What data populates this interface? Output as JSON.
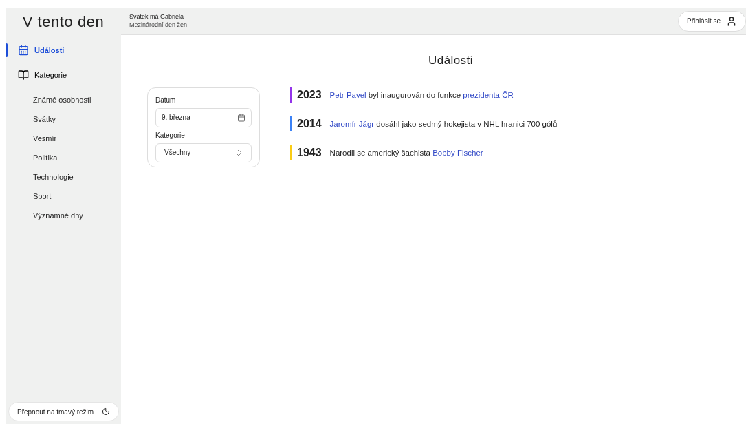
{
  "sidebar": {
    "title": "V tento den",
    "nav": [
      {
        "label": "Události",
        "kind": "calendar",
        "selected": true
      },
      {
        "label": "Kategorie",
        "kind": "book",
        "selected": false
      }
    ],
    "categories": [
      "Známé osobnosti",
      "Svátky",
      "Vesmír",
      "Politika",
      "Technologie",
      "Sport",
      "Významné dny"
    ],
    "theme_button": "Přepnout na tmavý režim"
  },
  "header": {
    "name_day": "Svátek má Gabriela",
    "day": "Mezinárodní den žen",
    "login_button": "Přihlásit se"
  },
  "main": {
    "title": "Události",
    "filter": {
      "date_label": "Datum",
      "date_value": "9. března",
      "category_label": "Kategorie",
      "category_value": "Všechny"
    },
    "events": [
      {
        "year": "2023",
        "color": "#9333ea",
        "parts": [
          {
            "kind": "link",
            "text": "Petr Pavel"
          },
          {
            "kind": "text",
            "text": " byl inaugurován do funkce "
          },
          {
            "kind": "link",
            "text": "prezidenta ČR"
          }
        ]
      },
      {
        "year": "2014",
        "color": "#3b82f6",
        "parts": [
          {
            "kind": "link",
            "text": "Jaromír Jágr"
          },
          {
            "kind": "text",
            "text": " dosáhl jako sedmý hokejista v NHL hranici 700 gólů"
          }
        ]
      },
      {
        "year": "1943",
        "color": "#facc15",
        "parts": [
          {
            "kind": "text",
            "text": "Narodil se americký šachista "
          },
          {
            "kind": "link",
            "text": "Bobby Fischer"
          }
        ]
      }
    ]
  }
}
